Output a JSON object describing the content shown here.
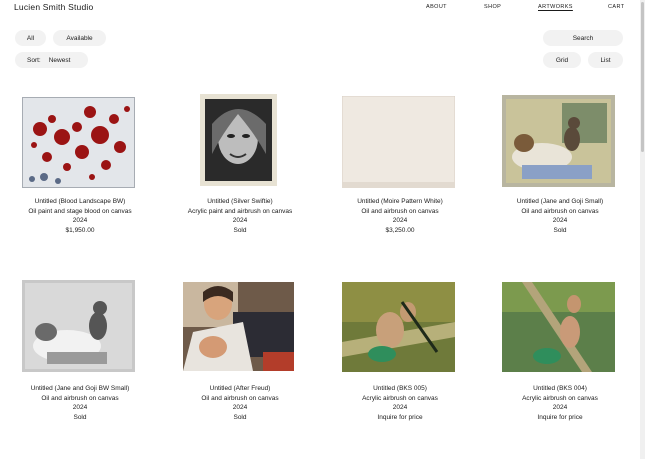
{
  "site": {
    "brand": "Lucien Smith Studio"
  },
  "nav": [
    {
      "label": "ABOUT",
      "active": false
    },
    {
      "label": "SHOP",
      "active": false
    },
    {
      "label": "ARTWORKS",
      "active": true
    },
    {
      "label": "CART",
      "active": false
    }
  ],
  "filters": {
    "all": "All",
    "available": "Available"
  },
  "search": {
    "label": "Search"
  },
  "sort": {
    "label": "Sort:",
    "value": "Newest"
  },
  "view": {
    "grid": "Grid",
    "list": "List"
  },
  "artworks": [
    {
      "title": "Untitled (Blood Landscape BW)",
      "medium": "Oil paint and stage blood on canvas",
      "year": "2024",
      "price": "$1,950.00"
    },
    {
      "title": "Untitled (Silver Swiftie)",
      "medium": "Acrylic paint and airbrush on canvas",
      "year": "2024",
      "price": "Sold"
    },
    {
      "title": "Untitled (Moire Pattern White)",
      "medium": "Oil and airbrush on canvas",
      "year": "2024",
      "price": "$3,250.00"
    },
    {
      "title": "Untitled (Jane and Goji Small)",
      "medium": "Oil and airbrush on canvas",
      "year": "2024",
      "price": "Sold"
    },
    {
      "title": "Untitled (Jane and Goji BW Small)",
      "medium": "Oil and airbrush on canvas",
      "year": "2024",
      "price": "Sold"
    },
    {
      "title": "Untitled (After Freud)",
      "medium": "Oil and airbrush on canvas",
      "year": "2024",
      "price": "Sold"
    },
    {
      "title": "Untitled (BKS 005)",
      "medium": "Acrylic airbrush on canvas",
      "year": "2024",
      "price": "Inquire for price"
    },
    {
      "title": "Untitled (BKS 004)",
      "medium": "Acrylic airbrush on canvas",
      "year": "2024",
      "price": "Inquire for price"
    }
  ]
}
